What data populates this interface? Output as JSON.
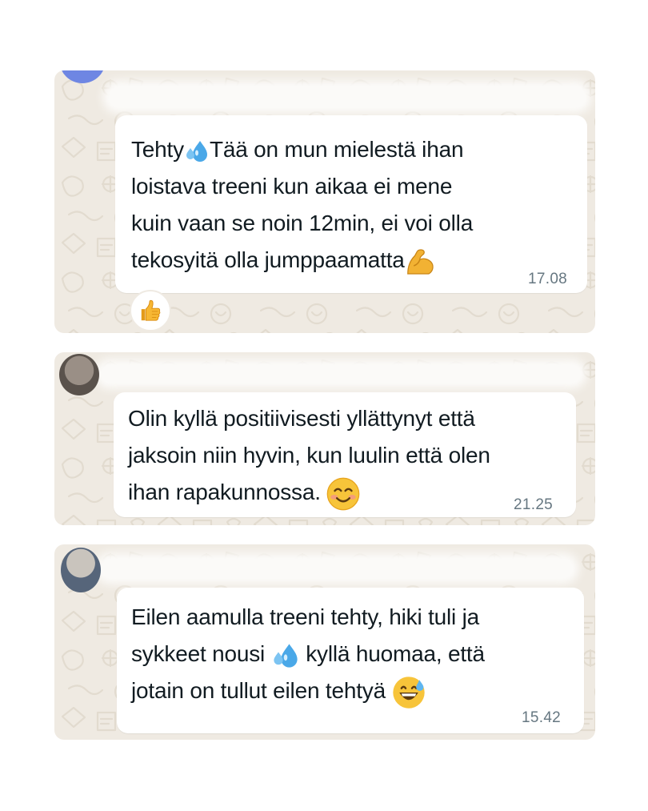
{
  "chat": {
    "messages": [
      {
        "lines": [
          "Tehty",
          "Tää on mun mielestä ihan",
          "loistava treeni kun aikaa ei mene",
          "kuin vaan se noin 12min, ei voi olla",
          "tekosyitä olla jumppaamatta"
        ],
        "time": "17.08",
        "reaction": "thumbs-up-icon",
        "emojis": [
          "sweat-droplets-icon",
          "flexed-biceps-icon"
        ]
      },
      {
        "lines": [
          "Olin kyllä positiivisesti yllättynyt että",
          "jaksoin niin hyvin, kun luulin että olen",
          "ihan rapakunnossa."
        ],
        "time": "21.25",
        "emojis": [
          "smiling-face-icon"
        ]
      },
      {
        "lines": [
          "Eilen aamulla treeni tehty, hiki tuli ja",
          "sykkeet nousi",
          "kyllä huomaa, että",
          "jotain on tullut eilen tehtyä"
        ],
        "time": "15.42",
        "emojis": [
          "sweat-droplets-icon",
          "grinning-sweat-face-icon"
        ]
      }
    ]
  },
  "colors": {
    "wallpaper": "#efeae2",
    "bubble": "#ffffff",
    "text": "#111b21",
    "timestamp": "#667781"
  }
}
